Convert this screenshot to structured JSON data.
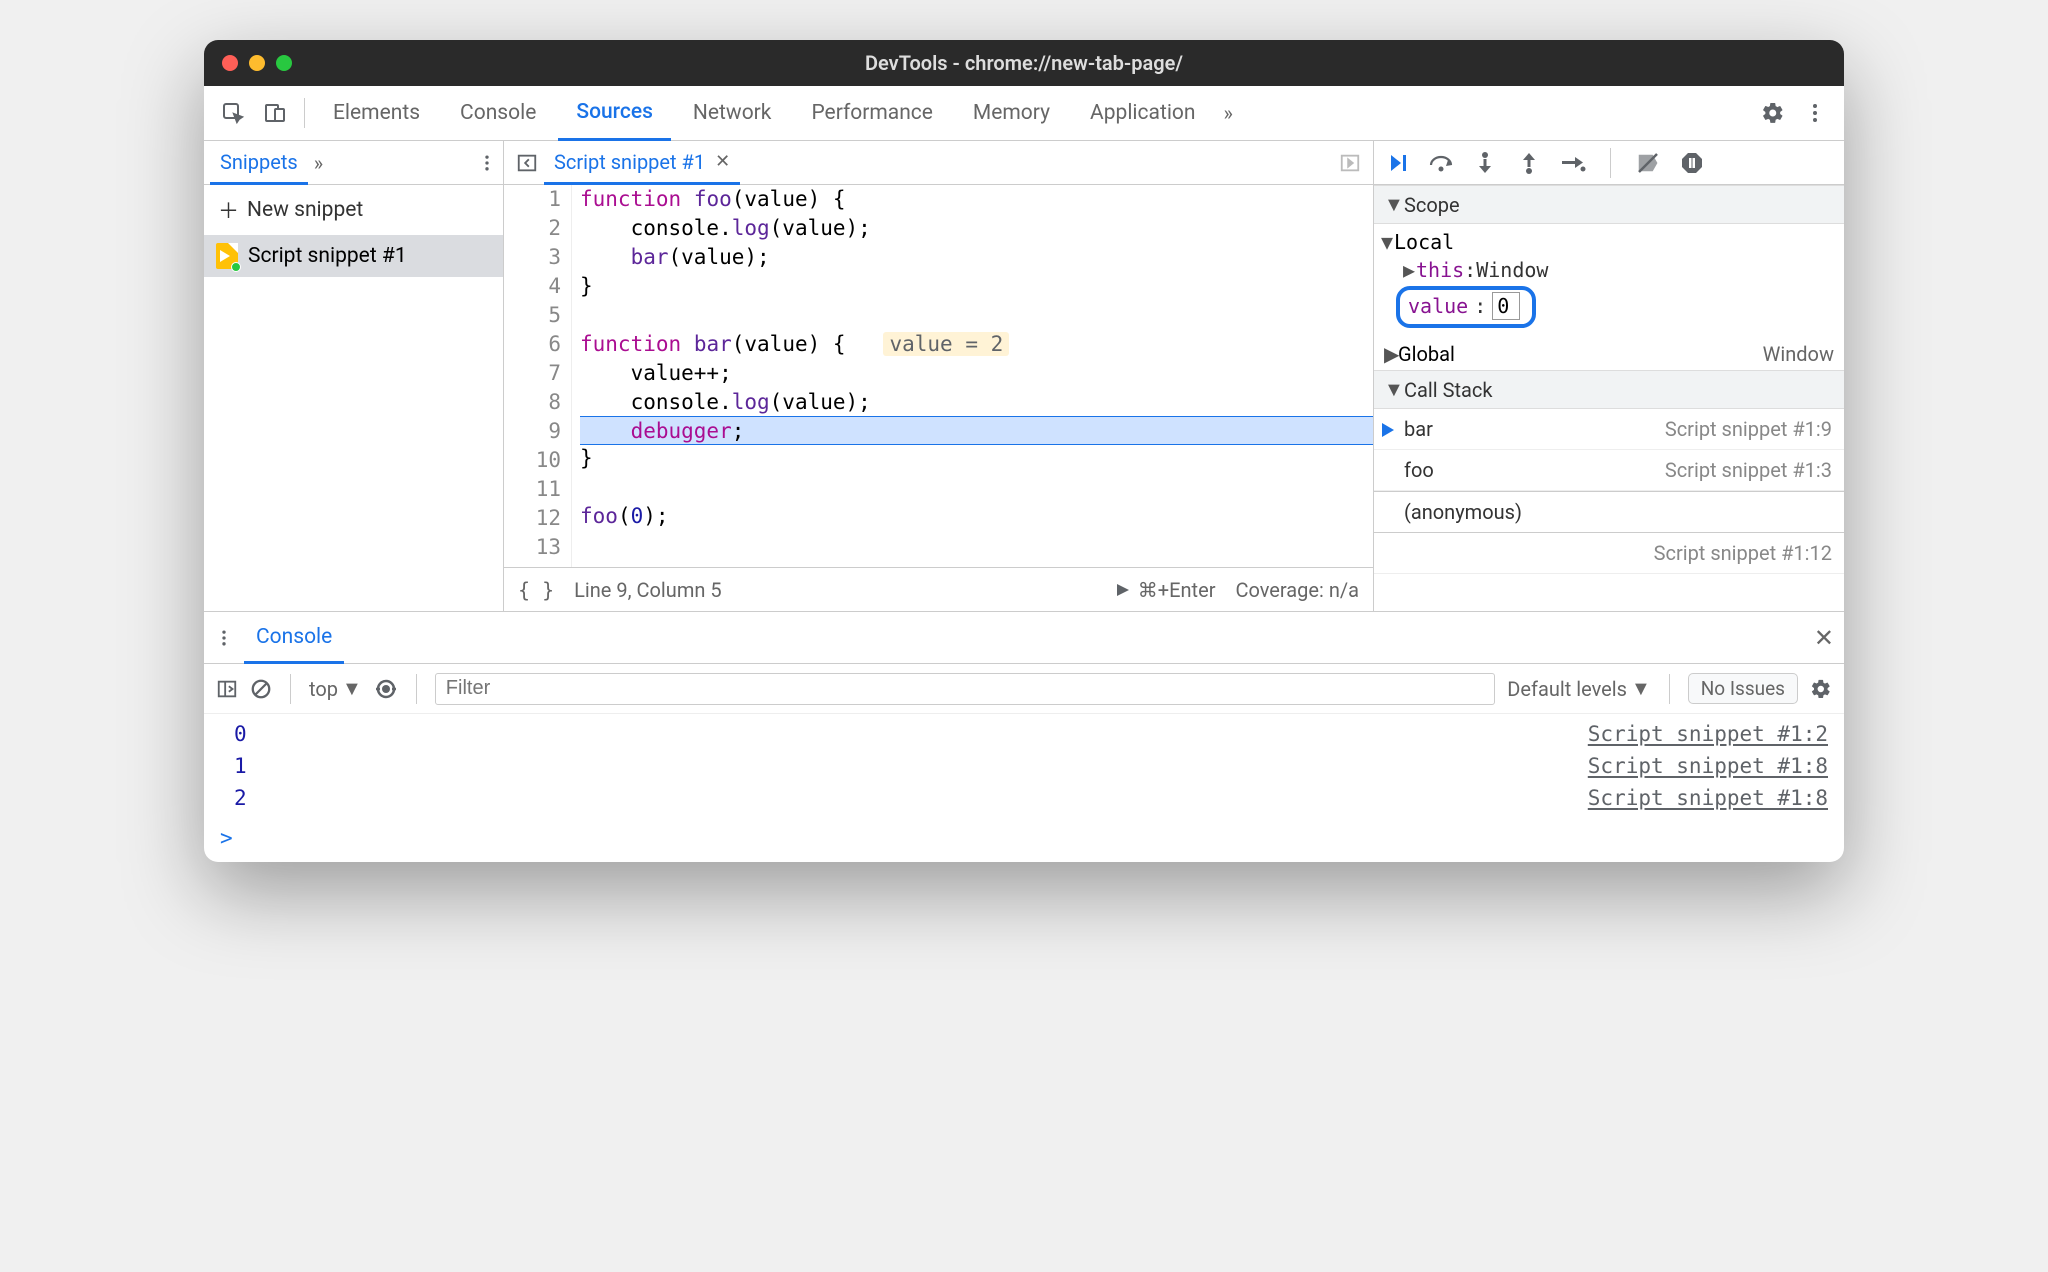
{
  "window": {
    "title": "DevTools - chrome://new-tab-page/"
  },
  "tabs": {
    "items": [
      "Elements",
      "Console",
      "Sources",
      "Network",
      "Performance",
      "Memory",
      "Application"
    ],
    "active": "Sources"
  },
  "sidebar": {
    "tab": "Snippets",
    "new_snippet": "New snippet",
    "items": [
      "Script snippet #1"
    ]
  },
  "editor": {
    "tab": "Script snippet #1",
    "lines": [
      {
        "n": 1,
        "tokens": [
          {
            "t": "kw",
            "v": "function"
          },
          {
            "t": "sp",
            "v": " "
          },
          {
            "t": "fn",
            "v": "foo"
          },
          {
            "t": "pl",
            "v": "(value) {"
          }
        ]
      },
      {
        "n": 2,
        "tokens": [
          {
            "t": "pl",
            "v": "    console."
          },
          {
            "t": "fn",
            "v": "log"
          },
          {
            "t": "pl",
            "v": "(value);"
          }
        ]
      },
      {
        "n": 3,
        "tokens": [
          {
            "t": "pl",
            "v": "    "
          },
          {
            "t": "fn",
            "v": "bar"
          },
          {
            "t": "pl",
            "v": "(value);"
          }
        ]
      },
      {
        "n": 4,
        "tokens": [
          {
            "t": "pl",
            "v": "}"
          }
        ]
      },
      {
        "n": 5,
        "tokens": []
      },
      {
        "n": 6,
        "tokens": [
          {
            "t": "kw",
            "v": "function"
          },
          {
            "t": "sp",
            "v": " "
          },
          {
            "t": "fn",
            "v": "bar"
          },
          {
            "t": "pl",
            "v": "(value) {   "
          },
          {
            "t": "inlay",
            "v": "value = 2"
          }
        ]
      },
      {
        "n": 7,
        "tokens": [
          {
            "t": "pl",
            "v": "    value++;"
          }
        ]
      },
      {
        "n": 8,
        "tokens": [
          {
            "t": "pl",
            "v": "    console."
          },
          {
            "t": "fn",
            "v": "log"
          },
          {
            "t": "pl",
            "v": "(value);"
          }
        ]
      },
      {
        "n": 9,
        "current": true,
        "tokens": [
          {
            "t": "pl",
            "v": "    "
          },
          {
            "t": "kw",
            "v": "debugger"
          },
          {
            "t": "pl",
            "v": ";"
          }
        ]
      },
      {
        "n": 10,
        "tokens": [
          {
            "t": "pl",
            "v": "}"
          }
        ]
      },
      {
        "n": 11,
        "tokens": []
      },
      {
        "n": 12,
        "tokens": [
          {
            "t": "fn",
            "v": "foo"
          },
          {
            "t": "pl",
            "v": "("
          },
          {
            "t": "num",
            "v": "0"
          },
          {
            "t": "pl",
            "v": ");"
          }
        ]
      },
      {
        "n": 13,
        "tokens": []
      }
    ],
    "status_cursor": "Line 9, Column 5",
    "status_run": "⌘+Enter",
    "status_coverage": "Coverage: n/a"
  },
  "scope": {
    "title": "Scope",
    "local": {
      "label": "Local",
      "this_key": "this",
      "this_val": "Window",
      "value_key": "value",
      "value_val": "0"
    },
    "global": {
      "label": "Global",
      "val": "Window"
    }
  },
  "callstack": {
    "title": "Call Stack",
    "frames": [
      {
        "fn": "bar",
        "loc": "Script snippet #1:9",
        "current": true
      },
      {
        "fn": "foo",
        "loc": "Script snippet #1:3"
      },
      {
        "fn": "(anonymous)",
        "loc": "Script snippet #1:12",
        "anon": true
      }
    ]
  },
  "drawer": {
    "tab": "Console",
    "context": "top",
    "filter_placeholder": "Filter",
    "levels": "Default levels",
    "no_issues": "No Issues",
    "outputs": [
      {
        "val": "0",
        "link": "Script snippet #1:2"
      },
      {
        "val": "1",
        "link": "Script snippet #1:8"
      },
      {
        "val": "2",
        "link": "Script snippet #1:8"
      }
    ],
    "prompt": ">"
  }
}
